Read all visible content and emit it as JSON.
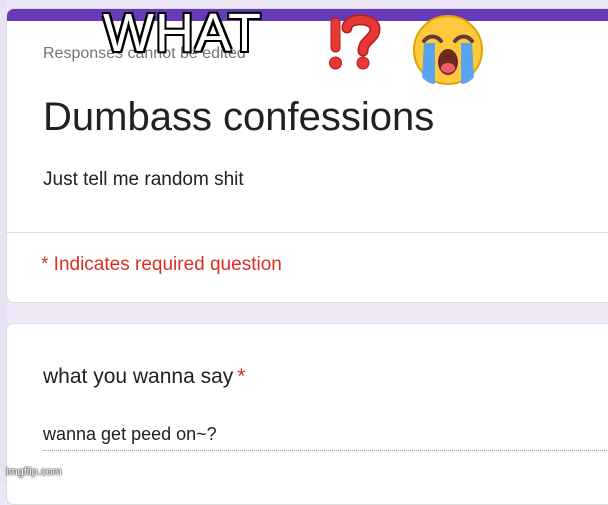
{
  "caption": {
    "text": "WHAT",
    "emoji": [
      "interrobang-icon",
      "loudly-crying-face-icon"
    ]
  },
  "form": {
    "accent_color": "#673ab7",
    "response_note": "Responses cannot be edited",
    "title": "Dumbass confessions",
    "description": "Just tell me random shit",
    "required_note": "* Indicates required question"
  },
  "question": {
    "label": "what you wanna say",
    "required_marker": "*",
    "answer": "wanna get peed on~?"
  },
  "watermark": "imgflip.com"
}
